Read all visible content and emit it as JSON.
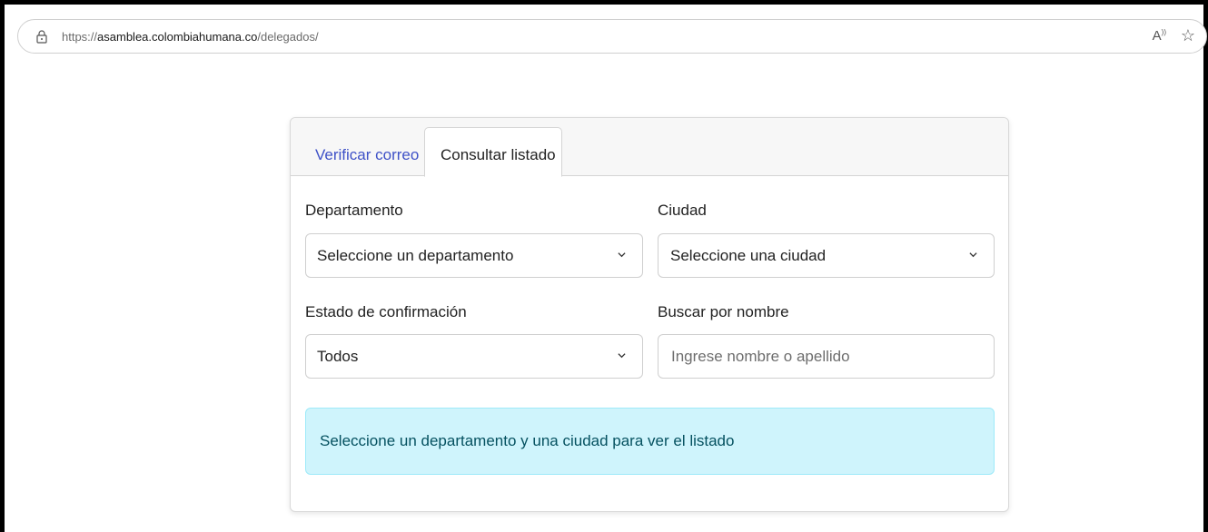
{
  "browser": {
    "url_protocol": "https://",
    "url_domain": "asamblea.colombiahumana.co",
    "url_path": "/delegados/"
  },
  "tabs": {
    "verificar": "Verificar correo",
    "consultar": "Consultar listado",
    "active": "consultar"
  },
  "form": {
    "departamento_label": "Departamento",
    "departamento_value": "Seleccione un departamento",
    "ciudad_label": "Ciudad",
    "ciudad_value": "Seleccione una ciudad",
    "estado_label": "Estado de confirmación",
    "estado_value": "Todos",
    "buscar_label": "Buscar por nombre",
    "buscar_placeholder": "Ingrese nombre o apellido",
    "buscar_value": ""
  },
  "alert": {
    "message": "Seleccione un departamento y una ciudad para ver el listado"
  },
  "colors": {
    "link_tab": "#3e51c7",
    "alert_bg": "#cff4fc",
    "alert_text": "#055160"
  }
}
